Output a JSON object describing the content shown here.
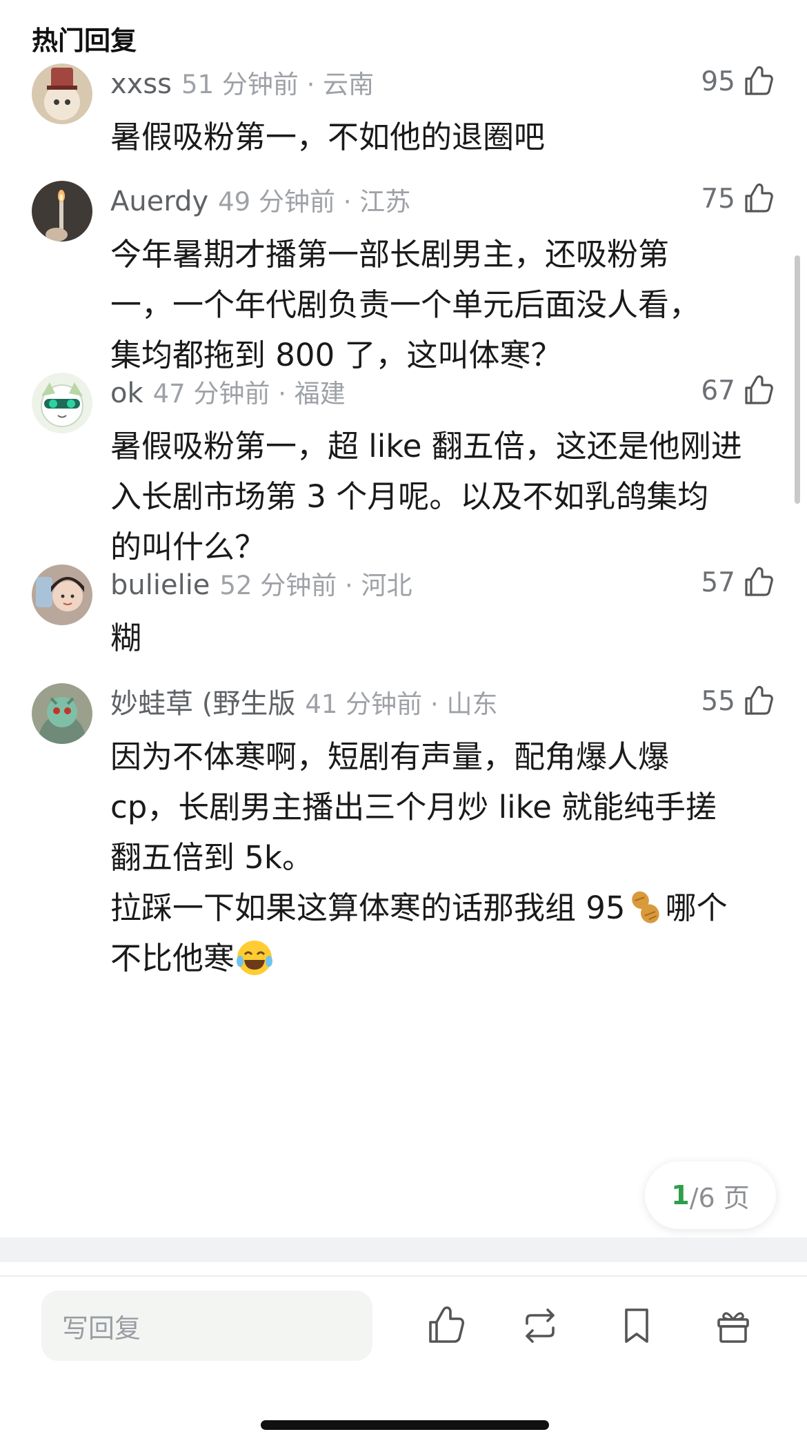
{
  "section_title": "热门回复",
  "comments": [
    {
      "username": "xxss",
      "time_location": "51 分钟前 · 云南",
      "likes": "95",
      "lines": [
        "暑假吸粉第一，不如他的退圈吧"
      ]
    },
    {
      "username": "Auerdy",
      "time_location": "49 分钟前 · 江苏",
      "likes": "75",
      "lines": [
        "今年暑期才播第一部长剧男主，还吸粉第",
        "一，一个年代剧负责一个单元后面没人看，",
        "集均都拖到 800 了，这叫体寒？"
      ]
    },
    {
      "username": "ok",
      "time_location": "47 分钟前 · 福建",
      "likes": "67",
      "lines": [
        "暑假吸粉第一，超 like 翻五倍，这还是他刚进",
        "入长剧市场第 3 个月呢。以及不如乳鸽集均",
        "的叫什么？"
      ]
    },
    {
      "username": "bulielie",
      "time_location": "52 分钟前 · 河北",
      "likes": "57",
      "lines": [
        "糊"
      ]
    },
    {
      "username": "妙蛙草 (野生版",
      "time_location": "41 分钟前 · 山东",
      "likes": "55",
      "lines": [
        "因为不体寒啊，短剧有声量，配角爆人爆",
        "cp，长剧男主播出三个月炒 like 就能纯手搓",
        "翻五倍到 5k。"
      ],
      "line4_before": "拉踩一下如果这算体寒的话那我组 95",
      "line4_after": "哪个",
      "line5_before": "不比他寒"
    }
  ],
  "pagination": {
    "current": "1",
    "total": "/6 页"
  },
  "reply_placeholder": "写回复",
  "icons": {
    "like": "thumbs-up-icon",
    "repost": "repost-icon",
    "bookmark": "bookmark-icon",
    "gift": "gift-icon",
    "peanut": "peanut-emoji",
    "laugh": "tears-of-joy-emoji"
  }
}
